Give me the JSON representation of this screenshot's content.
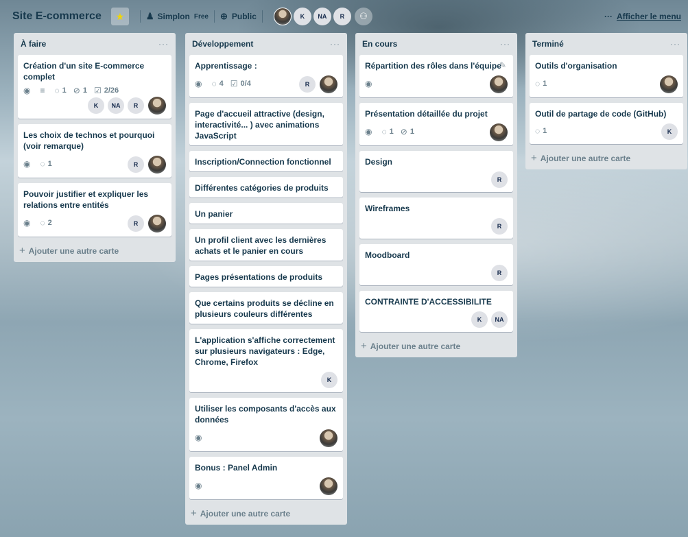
{
  "header": {
    "board_name": "Site E-commerce",
    "star_icon": "star-icon",
    "team_name": "Simplon",
    "plan": "Free",
    "visibility": "Public",
    "members": [
      "K",
      "NA",
      "R"
    ],
    "menu_dots": "···",
    "menu_label": "Afficher le menu"
  },
  "lists": [
    {
      "title": "À faire",
      "menu": "···",
      "cards": [
        {
          "title": "Création d'un site E-commerce complet",
          "badges": {
            "comments": "1",
            "attachments": "1",
            "checklist": "2/26"
          },
          "members": [
            "K",
            "NA",
            "R"
          ]
        },
        {
          "title": "Les choix de technos et pourquoi (voir remarque)",
          "badges": {
            "comments": "1"
          },
          "members": [
            "R"
          ]
        },
        {
          "title": "Pouvoir justifier et expliquer les relations entre entités",
          "badges": {
            "comments": "2"
          },
          "members": [
            "R"
          ]
        }
      ],
      "add_label": "Ajouter une autre carte"
    },
    {
      "title": "Développement",
      "menu": "···",
      "cards": [
        {
          "title": "Apprentissage :",
          "badges": {
            "comments": "4",
            "checklist": "0/4"
          },
          "members": [
            "R"
          ]
        },
        {
          "title": "Page d'accueil attractive (design, interactivité... ) avec animations JavaScript"
        },
        {
          "title": "Inscription/Connection fonctionnel"
        },
        {
          "title": "Différentes catégories de produits"
        },
        {
          "title": "Un panier"
        },
        {
          "title": "Un profil client avec les dernières achats et le panier en cours"
        },
        {
          "title": "Pages présentations de produits"
        },
        {
          "title": "Que certains produits se décline en plusieurs couleurs différentes"
        },
        {
          "title": "L'application s'affiche correctement sur plusieurs navigateurs : Edge, Chrome, Firefox",
          "members": [
            "K"
          ]
        },
        {
          "title": "Utiliser les composants d'accès aux données"
        },
        {
          "title": "Bonus : Panel Admin"
        }
      ],
      "add_label": "Ajouter une autre carte"
    },
    {
      "title": "En cours",
      "menu": "···",
      "cards": [
        {
          "title": "Répartition des rôles dans l'équipe"
        },
        {
          "title": "Présentation détaillée du projet",
          "badges": {
            "comments": "1",
            "attachments": "1"
          }
        },
        {
          "title": "Design",
          "members": [
            "R"
          ]
        },
        {
          "title": "Wireframes",
          "members": [
            "R"
          ]
        },
        {
          "title": "Moodboard",
          "members": [
            "R"
          ]
        },
        {
          "title": "CONTRAINTE D'ACCESSIBILITE",
          "members": [
            "K",
            "NA"
          ]
        }
      ],
      "add_label": "Ajouter une autre carte"
    },
    {
      "title": "Terminé",
      "menu": "···",
      "cards": [
        {
          "title": "Outils d'organisation",
          "badges": {
            "comments": "1"
          }
        },
        {
          "title": "Outil de partage de code (GitHub)",
          "badges": {
            "comments": "1"
          },
          "members": [
            "K"
          ]
        }
      ],
      "add_label": "Ajouter une autre carte"
    }
  ]
}
